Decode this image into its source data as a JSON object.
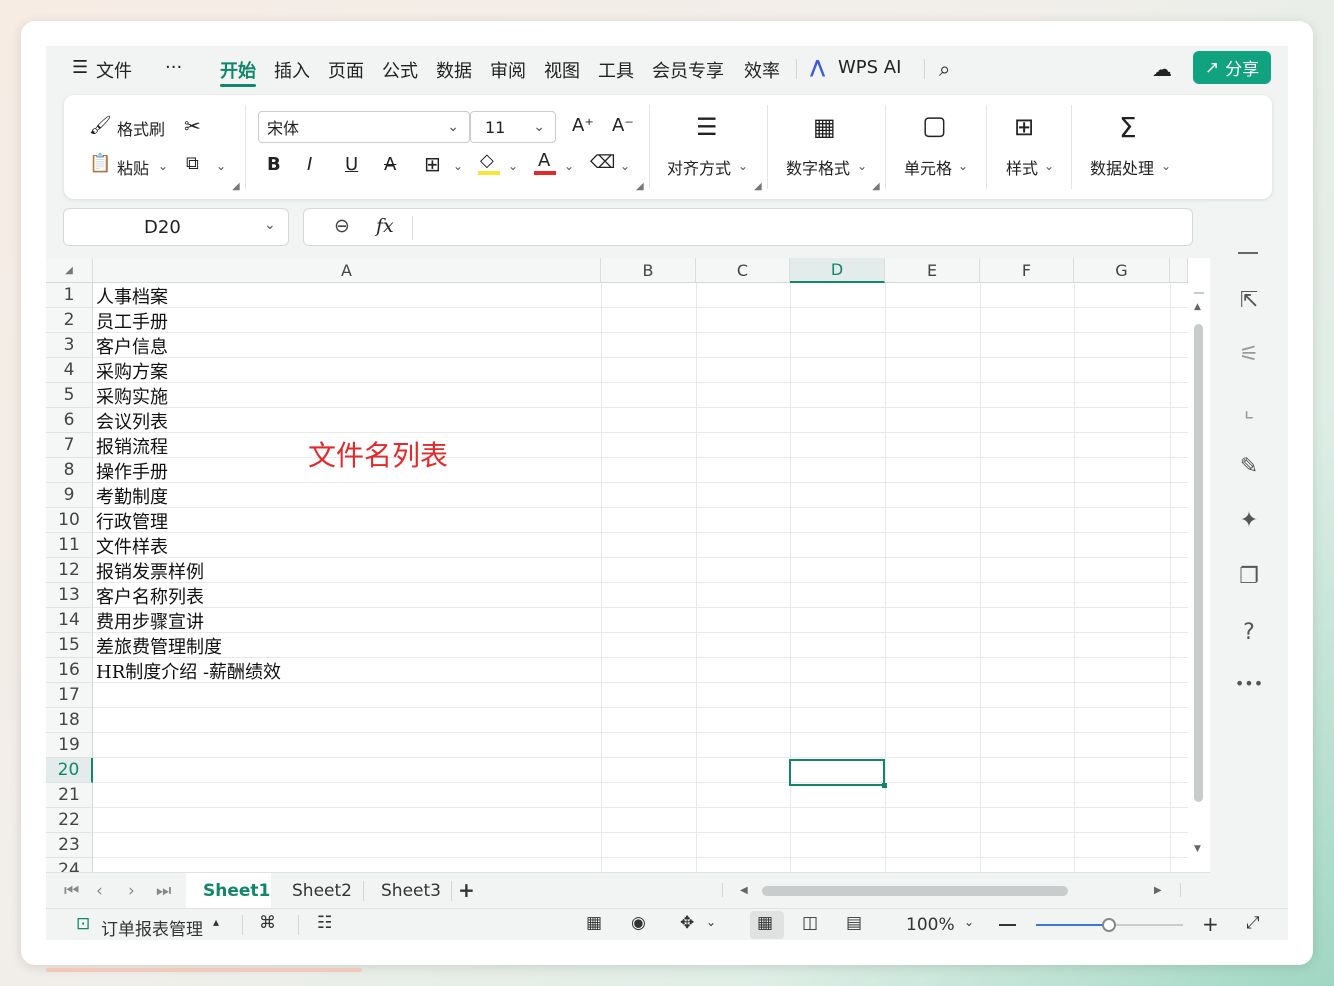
{
  "menu": {
    "file_label": "文件",
    "more_label": "···",
    "tabs": [
      "开始",
      "插入",
      "页面",
      "公式",
      "数据",
      "审阅",
      "视图",
      "工具",
      "会员专享",
      "效率"
    ],
    "wps_ai": "WPS AI",
    "share": "分享"
  },
  "ribbon": {
    "format_painter": "格式刷",
    "paste": "粘贴",
    "font_name": "宋体",
    "font_size": "11",
    "bold": "B",
    "italic": "I",
    "underline": "U",
    "strike": "A",
    "font_color_glyph": "A",
    "align": "对齐方式",
    "number_format": "数字格式",
    "cell": "单元格",
    "style": "样式",
    "data_process": "数据处理"
  },
  "formula": {
    "name_box": "D20",
    "fx": "fx",
    "value": ""
  },
  "columns": [
    "A",
    "B",
    "C",
    "D",
    "E",
    "F",
    "G"
  ],
  "rows": [
    "1",
    "2",
    "3",
    "4",
    "5",
    "6",
    "7",
    "8",
    "9",
    "10",
    "11",
    "12",
    "13",
    "14",
    "15",
    "16",
    "17",
    "18",
    "19",
    "20",
    "21",
    "22",
    "23",
    "24"
  ],
  "cells_a": [
    "人事档案",
    "员工手册",
    "客户信息",
    "采购方案",
    "采购实施",
    "会议列表",
    "报销流程",
    "操作手册",
    "考勤制度",
    "行政管理",
    "文件样表",
    "报销发票样例",
    "客户名称列表",
    "费用步骤宣讲",
    "差旅费管理制度",
    "HR制度介绍 -薪酬绩效"
  ],
  "annotation": "文件名列表",
  "sheets": [
    "Sheet1",
    "Sheet2",
    "Sheet3"
  ],
  "add_sheet": "+",
  "status": {
    "doc_label": "订单报表管理",
    "zoom": "100%"
  },
  "colors": {
    "accent": "#11866a",
    "share_bg": "#11a37f",
    "annotation": "#e3292a",
    "font_color_bar": "#e3292a",
    "highlight_bar": "#f5e63a"
  }
}
